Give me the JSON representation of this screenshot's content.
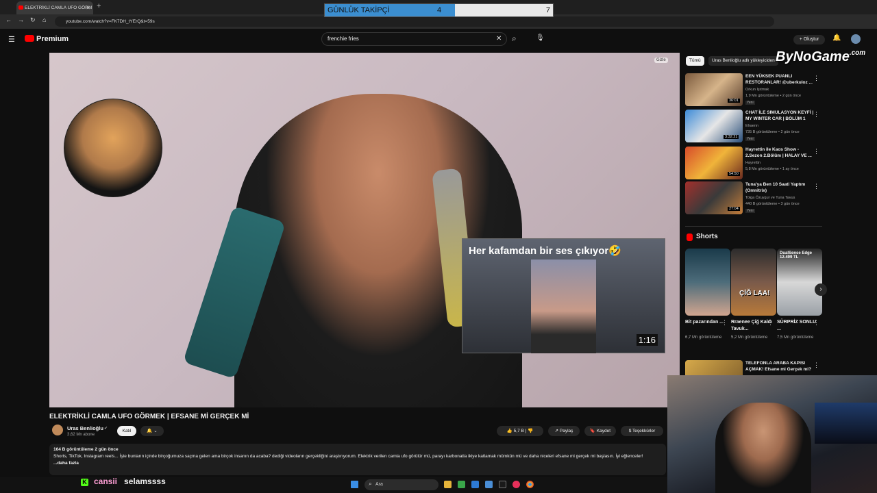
{
  "browser": {
    "tab_title": "ELEKTRİKLİ CAMLA UFO GÖRM",
    "url": "youtube.com/watch?v=FK7DH_tYErQ&t=59s"
  },
  "tracker": {
    "label": "GÜNLÜK TAKİPÇİ",
    "current": "4",
    "goal": "7",
    "progress_fraction": 0.57,
    "accent": "#3b8ed0"
  },
  "header": {
    "logo": "Premium",
    "search_value": "frenchie fries",
    "create_label": "Oluştur"
  },
  "video": {
    "hide_label": "Gizle",
    "overlay_title": "Her kafamdan bir ses çıkıyor🤣",
    "overlay_duration": "1:16",
    "title": "ELEKTRİKLİ CAMLA UFO GÖRMEK | EFSANE Mİ GERÇEK Mİ",
    "channel": "Uras Benlioğlu",
    "subscribers": "3,62 Mn abone",
    "join_label": "Katıl",
    "likes": "5,7 B",
    "share": "Paylaş",
    "save": "Kaydet",
    "thanks": "Teşekkürler",
    "views": "164 B görüntüleme  2 gün önce",
    "description": "Shorts, TikTok, Instagram reels... İşte bunların içinde birçoğumuza saçma gelen ama birçok insanın da acaba? dediği videoların gerçekliğini araştırıyorum. Elektrik verilen camla ufo görülür mü, parayı karbonatla ikiye katlamak mümkün mü ve daha niceleri efsane mi gerçek mi başlasın. İyi eğlenceler!",
    "more": "...daha fazla"
  },
  "sidebar": {
    "chips": [
      "Tümü",
      "Uras Benlioğlu adlı yükleyiciden"
    ],
    "recs": [
      {
        "title": "EEN YÜKSEK PUANLI RESTORANLAR! @uberkuloz ...",
        "channel": "Orkun Işıtmak",
        "meta": "1,9 Mn görüntüleme • 2 gün önce",
        "duration": "36:01",
        "badge": "Yeni"
      },
      {
        "title": "CHAT İLE SIMULASYON KEYFİ | MY WINTER CAR | BÖLÜM 1",
        "channel": "Elraenn",
        "meta": "735 B görüntüleme • 2 gün önce",
        "duration": "3:32:21",
        "badge": "Yeni"
      },
      {
        "title": "Hayrettin ile Kaos Show - 2.Sezon 2.Bölüm | HALAY VE ...",
        "channel": "Hayrettin",
        "meta": "5,8 Mn görüntüleme • 1 ay önce",
        "duration": "54:50",
        "badge": ""
      },
      {
        "title": "Tuna'ya Ben 10 Saati Yaptım (Omnitrix)",
        "channel": "Tolga Özuygur ve Tuna Tavus",
        "meta": "440 B görüntüleme • 3 gün önce",
        "duration": "27:04",
        "badge": "Yeni"
      }
    ],
    "shorts_label": "Shorts",
    "shorts": [
      {
        "title": "Bit pazarından ...",
        "views": "6,7 Mn görüntüleme"
      },
      {
        "title": "Rraenee Çiğ Kaldı Tavuk...",
        "views": "5,2 Mn görüntüleme"
      },
      {
        "title": "SÜRPRİZ SONLU ...",
        "views": "7,5 Mn görüntüleme"
      }
    ],
    "short_overlay_1": "ÇİĞ LAA!",
    "short_overlay_2": "DualSense Edge 12.499 TL",
    "rec5_title": "TELEFONLA ARABA KAPISI AÇMAK! Efsane mi Gerçek mi?"
  },
  "watermark": "ByNoGame",
  "watermark_sub": ".com",
  "chat": {
    "user": "cansii",
    "message": "selamssss"
  },
  "taskbar": {
    "search_placeholder": "Ara"
  }
}
